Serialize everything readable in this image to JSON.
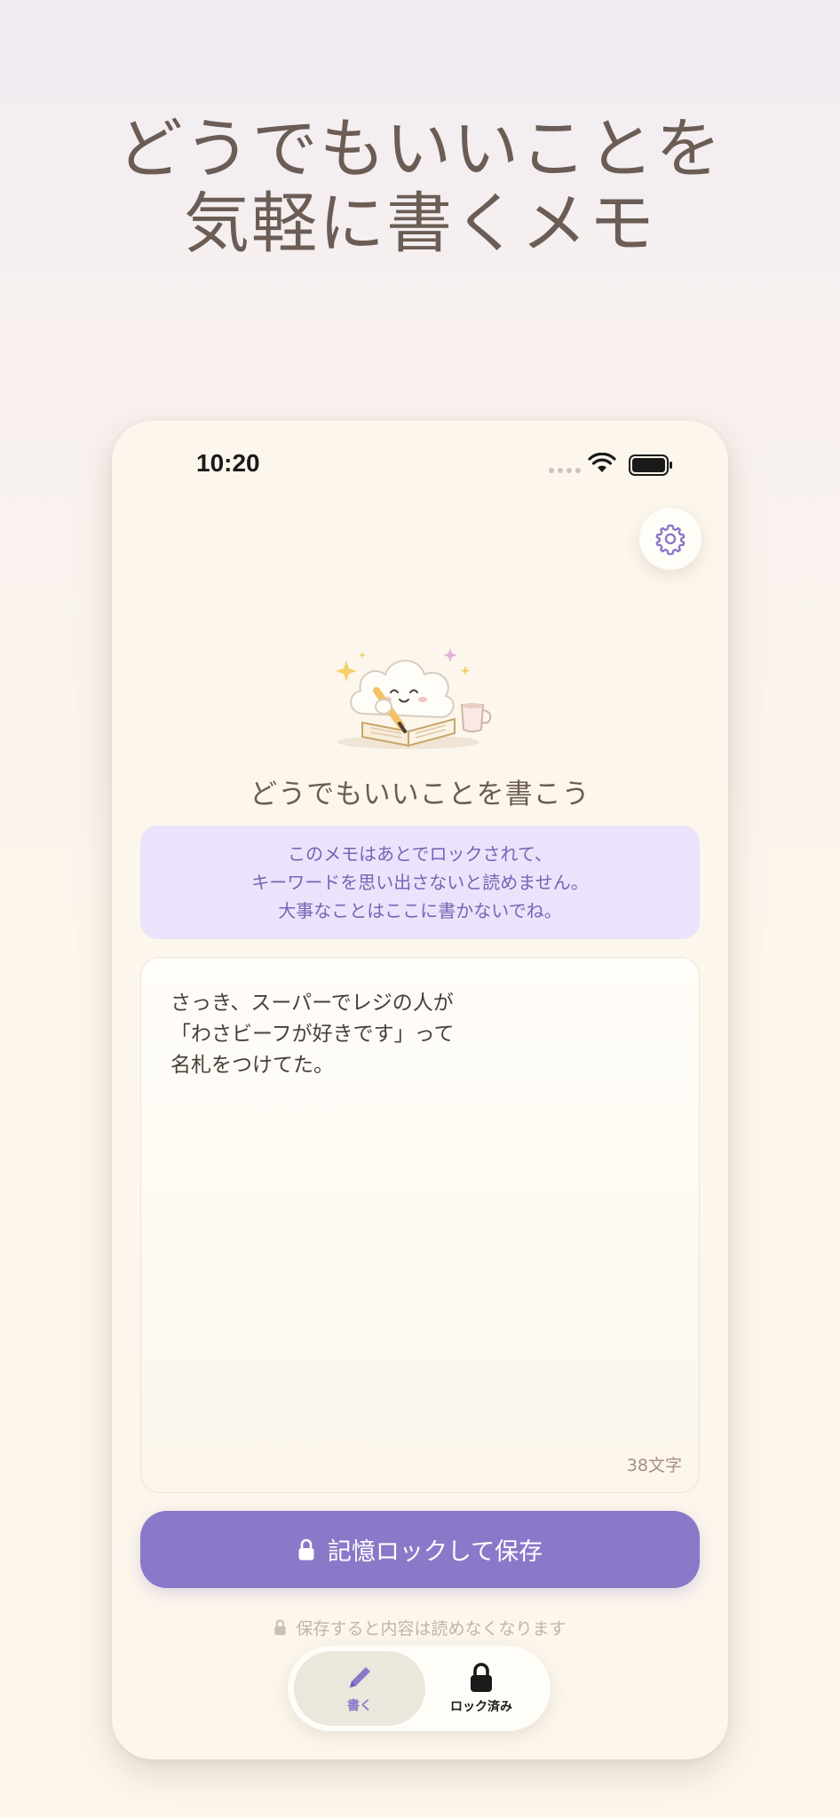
{
  "headline": {
    "line1": "どうでもいいことを",
    "line2": "気軽に書くメモ"
  },
  "status_bar": {
    "time": "10:20"
  },
  "main": {
    "title": "どうでもいいことを書こう",
    "notice_lines": [
      "このメモはあとでロックされて、",
      "キーワードを思い出さないと読めません。",
      "大事なことはここに書かないでね。"
    ],
    "memo": {
      "lines": [
        "さっき、スーパーでレジの人が",
        "「わさビーフが好きです」って",
        "名札をつけてた。"
      ],
      "char_count": "38文字"
    },
    "save_button": "記憶ロックして保存",
    "save_hint": "保存すると内容は読めなくなります"
  },
  "tabs": [
    {
      "label": "書く",
      "icon": "pencil-icon",
      "active": true
    },
    {
      "label": "ロック済み",
      "icon": "lock-icon",
      "active": false
    }
  ],
  "colors": {
    "accent": "#8a78c9",
    "notice_bg": "#ebe3fb",
    "notice_text": "#7b62b6",
    "text_brown": "#6b5d55",
    "background": "#fcf6ec"
  }
}
